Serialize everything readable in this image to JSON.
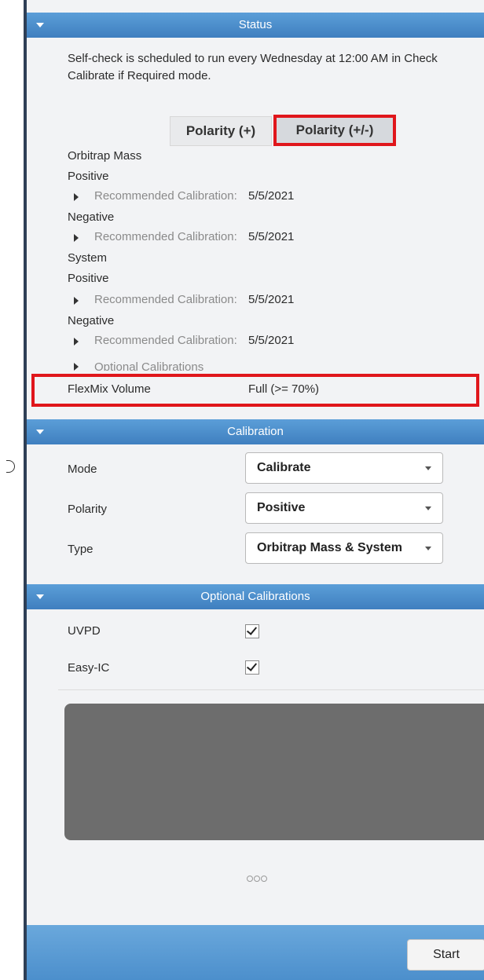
{
  "status": {
    "header": "Status",
    "message_line1": "Self-check is scheduled to run every Wednesday at 12:00 AM in Check",
    "message_line2": "Calibrate if Required mode.",
    "polarity_plus": "Polarity (+)",
    "polarity_plusminus": "Polarity (+/-)",
    "orbitrap_mass": "Orbitrap Mass",
    "positive_1": "Positive",
    "rec_label_1": "Recommended Calibration:",
    "rec_date_1": "5/5/2021",
    "negative_1": "Negative",
    "rec_label_2": "Recommended Calibration:",
    "rec_date_2": "5/5/2021",
    "system": "System",
    "positive_2": "Positive",
    "rec_label_3": "Recommended Calibration:",
    "rec_date_3": "5/5/2021",
    "negative_2": "Negative",
    "rec_label_4": "Recommended Calibration:",
    "rec_date_4": "5/5/2021",
    "optional_calibrations": "Optional Calibrations",
    "flexmix_label": "FlexMix Volume",
    "flexmix_value": "Full (>= 70%)"
  },
  "calibration": {
    "header": "Calibration",
    "mode_label": "Mode",
    "mode_value": "Calibrate",
    "polarity_label": "Polarity",
    "polarity_value": "Positive",
    "type_label": "Type",
    "type_value": "Orbitrap Mass & System"
  },
  "optional": {
    "header": "Optional Calibrations",
    "uvpd_label": "UVPD",
    "uvpd_checked": true,
    "easyic_label": "Easy-IC",
    "easyic_checked": true
  },
  "footer": {
    "start_label": "Start"
  }
}
